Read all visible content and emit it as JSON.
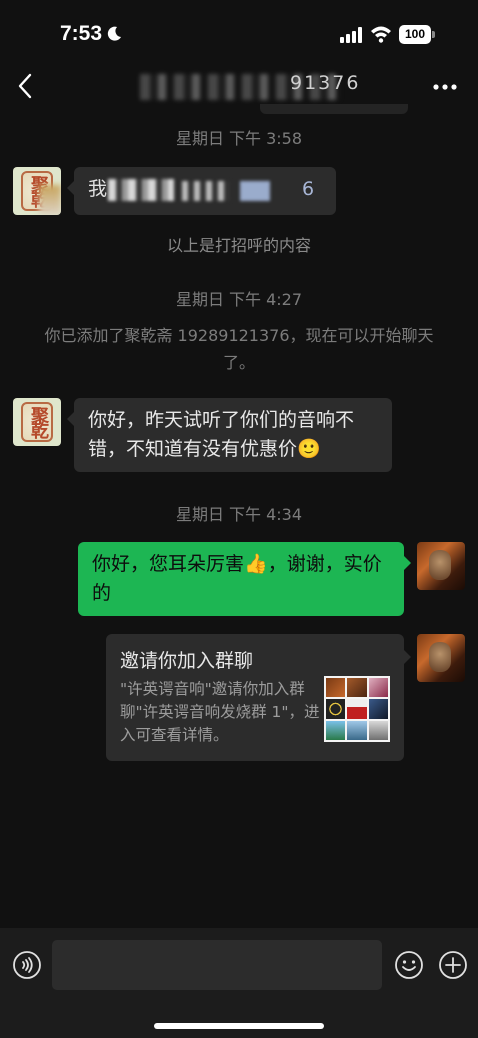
{
  "status_bar": {
    "time": "7:53",
    "battery": "100"
  },
  "nav": {
    "title": "",
    "title_fragment": "91376"
  },
  "messages": {
    "ts1": "星期日 下午 3:58",
    "greeting_blurred_prefix": "我"
  },
  "system": {
    "greeting_note": "以上是打招呼的内容",
    "ts2": "星期日 下午 4:27",
    "added_notice": "你已添加了聚乾斋 19289121376，现在可以开始聊天了。",
    "ts3": "星期日 下午 4:34"
  },
  "chat": {
    "incoming_text": "你好，昨天试听了你们的音响不错，不知道有没有优惠价",
    "incoming_emoji": "🙂",
    "outgoing_text_a": "你好，您耳朵厉害",
    "outgoing_emoji": "👍",
    "outgoing_text_b": "，谢谢，实价的"
  },
  "invite_card": {
    "title": "邀请你加入群聊",
    "desc": "\"许英谔音响\"邀请你加入群聊\"许英谔音响发烧群 1\"，进入可查看详情。"
  },
  "colors": {
    "background": "#111111",
    "bubble_incoming": "#2c2c2c",
    "bubble_outgoing": "#1db653",
    "input_bar": "#1c1c1c"
  },
  "icons": {
    "back": "chevron-left-icon",
    "more": "more-dots-icon",
    "voice": "voice-icon",
    "emoji": "emoji-icon",
    "plus": "plus-icon"
  }
}
